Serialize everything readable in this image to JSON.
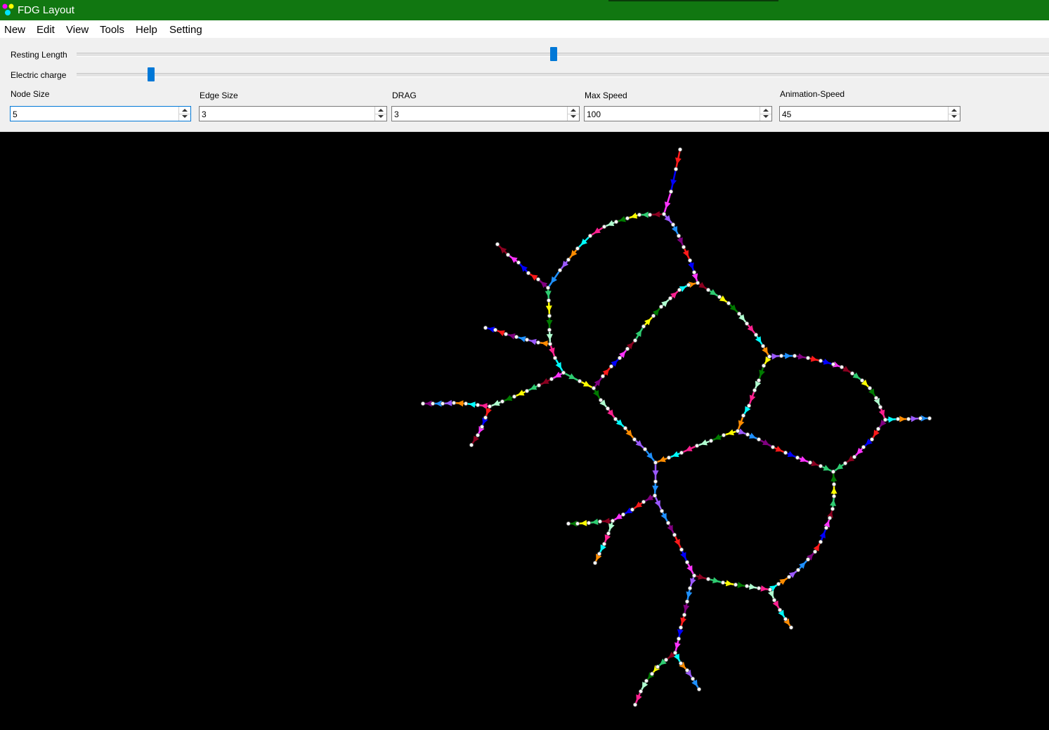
{
  "window": {
    "title": "FDG Layout"
  },
  "menu": [
    "New",
    "Edit",
    "View",
    "Tools",
    "Help",
    "Setting"
  ],
  "sliders": {
    "resting_length": {
      "label": "Resting Length",
      "value_fraction": 0.49
    },
    "electric_charge": {
      "label": "Electric charge",
      "value_fraction": 0.077
    }
  },
  "fields": {
    "node_size": {
      "label": "Node Size",
      "value": "5"
    },
    "edge_size": {
      "label": "Edge Size",
      "value": "3"
    },
    "drag": {
      "label": "DRAG",
      "value": "3"
    },
    "max_speed": {
      "label": "Max Speed",
      "value": "100"
    },
    "animation_speed": {
      "label": "Animation-Speed",
      "value": "45"
    }
  },
  "colors": {
    "titlebar": "#117711",
    "accent": "#0078d7",
    "canvas": "#000000",
    "edge_palette": [
      "#ff1a1a",
      "#ffff00",
      "#ff8c00",
      "#0000ff",
      "#007a00",
      "#9b59ff",
      "#ff33ff",
      "#b0ffd0",
      "#1e90ff",
      "#8b0020",
      "#ff2090",
      "#800080",
      "#2ecc71",
      "#00ffff"
    ]
  }
}
